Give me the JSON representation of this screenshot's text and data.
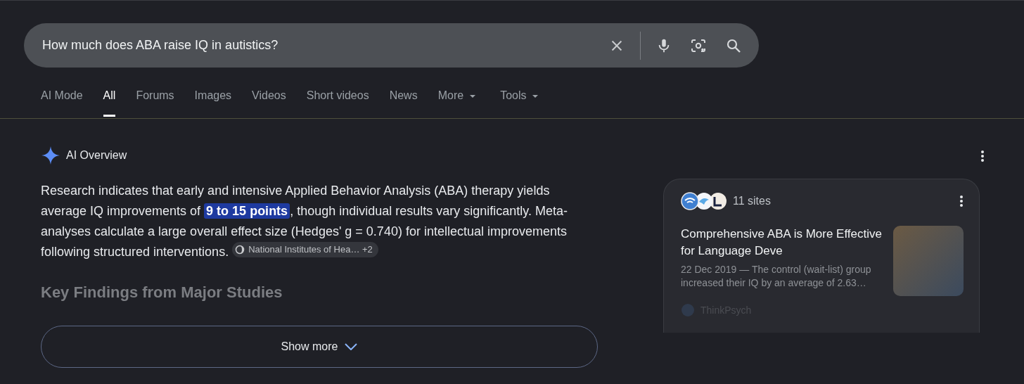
{
  "search": {
    "value": "How much does ABA raise IQ in autistics?"
  },
  "tabs": [
    {
      "label": "AI Mode",
      "selected": false,
      "dropdown": false
    },
    {
      "label": "All",
      "selected": true,
      "dropdown": false
    },
    {
      "label": "Forums",
      "selected": false,
      "dropdown": false
    },
    {
      "label": "Images",
      "selected": false,
      "dropdown": false
    },
    {
      "label": "Videos",
      "selected": false,
      "dropdown": false
    },
    {
      "label": "Short videos",
      "selected": false,
      "dropdown": false
    },
    {
      "label": "News",
      "selected": false,
      "dropdown": false
    },
    {
      "label": "More",
      "selected": false,
      "dropdown": true
    },
    {
      "label": "Tools",
      "selected": false,
      "dropdown": true
    }
  ],
  "overview": {
    "title": "AI Overview",
    "paragraph": "Research indicates that early and intensive Applied Behavior Analysis (ABA) therapy yields average IQ improvements of **9 to 15 points**, though individual results vary significantly. Meta-analyses calculate a large overall effect size (Hedges' g = 0.740) for intellectual improvements following structured interventions.",
    "source_chip": {
      "label": "National Institutes of Hea…",
      "count": "+2"
    },
    "heading": "Key Findings from Major Studies",
    "show_more": "Show more"
  },
  "sources_card": {
    "count": "11 sites",
    "result": {
      "title": "Comprehensive ABA is More Effective for Language Deve",
      "snippet": "22 Dec 2019 — The control (wait-list) group increased their IQ by an average of 2.63…",
      "site": "ThinkPsych"
    }
  }
}
